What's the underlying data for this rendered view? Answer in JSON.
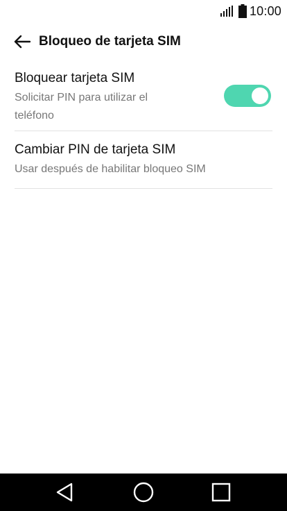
{
  "status_bar": {
    "time": "10:00",
    "icons": [
      "signal-icon",
      "battery-icon"
    ]
  },
  "toolbar": {
    "title": "Bloqueo de tarjeta SIM",
    "back_icon": "arrow-left-icon"
  },
  "settings": [
    {
      "title": "Bloquear tarjeta SIM",
      "subtitle": "Solicitar PIN para utilizar el teléfono",
      "toggle_on": true,
      "accent_color": "#4fd6b0"
    },
    {
      "title": "Cambiar PIN de tarjeta SIM",
      "subtitle": "Usar después de habilitar bloqueo SIM"
    }
  ],
  "nav_bar": {
    "buttons": [
      "back-triangle-icon",
      "home-circle-icon",
      "recents-square-icon"
    ]
  }
}
